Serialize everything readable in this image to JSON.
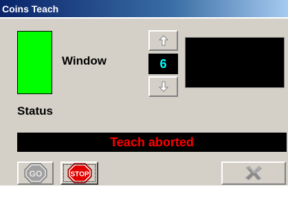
{
  "titlebar": {
    "title": "Coins Teach"
  },
  "labels": {
    "window": "Window",
    "status": "Status"
  },
  "window_spinner": {
    "value": "6",
    "up_icon": "arrow-up-icon",
    "down_icon": "arrow-down-icon"
  },
  "message": {
    "text": "Teach aborted"
  },
  "buttons": {
    "go_label": "GO",
    "stop_label": "STOP",
    "close_icon": "x-close-icon"
  },
  "colors": {
    "status_indicator": "#00ff00",
    "message_text": "#ff0000",
    "value_text": "#00ffff",
    "stop_red": "#e00000",
    "go_gray": "#9a9a9a"
  }
}
